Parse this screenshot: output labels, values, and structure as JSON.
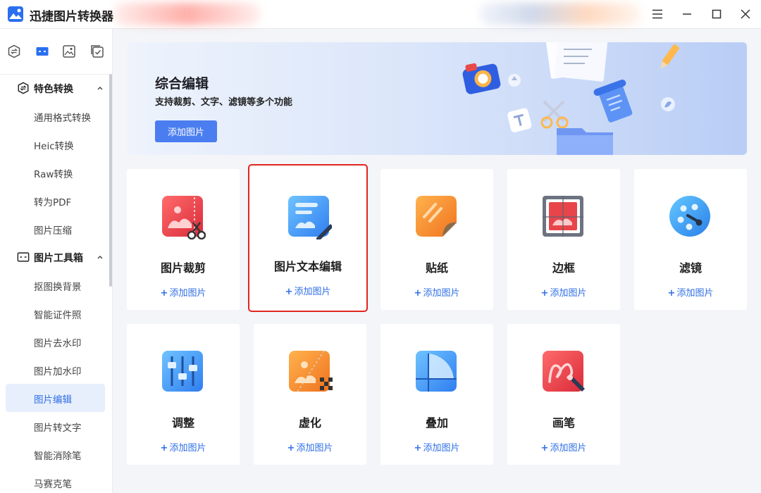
{
  "app": {
    "title": "迅捷图片转换器"
  },
  "window_controls": [
    "menu-icon",
    "minimize-icon",
    "maximize-icon",
    "close-icon"
  ],
  "sidebar": {
    "top_icons": [
      "convert-icon",
      "toolbox-icon",
      "image-icon",
      "checklist-icon"
    ],
    "groups": [
      {
        "label": "特色转换",
        "icon": "convert-icon",
        "expanded": true,
        "items": [
          "通用格式转换",
          "Heic转换",
          "Raw转换",
          "转为PDF",
          "图片压缩"
        ]
      },
      {
        "label": "图片工具箱",
        "icon": "toolbox-icon",
        "expanded": true,
        "items": [
          "抠图换背景",
          "智能证件照",
          "图片去水印",
          "图片加水印",
          "图片编辑",
          "图片转文字",
          "智能消除笔",
          "马赛克笔"
        ]
      }
    ],
    "active_item": "图片编辑"
  },
  "banner": {
    "title": "综合编辑",
    "subtitle": "支持裁剪、文字、滤镜等多个功能",
    "button_label": "添加图片"
  },
  "add_label": "添加图片",
  "add_symbol": "+",
  "cards": [
    {
      "title": "图片裁剪",
      "icon": "crop-icon"
    },
    {
      "title": "图片文本编辑",
      "icon": "text-edit-icon",
      "selected": true
    },
    {
      "title": "贴纸",
      "icon": "sticker-icon"
    },
    {
      "title": "边框",
      "icon": "frame-icon"
    },
    {
      "title": "滤镜",
      "icon": "filter-icon"
    },
    {
      "title": "调整",
      "icon": "adjust-icon"
    },
    {
      "title": "虚化",
      "icon": "blur-icon"
    },
    {
      "title": "叠加",
      "icon": "overlay-icon"
    },
    {
      "title": "画笔",
      "icon": "brush-icon"
    }
  ],
  "colors": {
    "accent": "#2f6fe6",
    "button": "#4a7df0",
    "selection_border": "#e0251f",
    "active_bg": "#e8effc"
  }
}
